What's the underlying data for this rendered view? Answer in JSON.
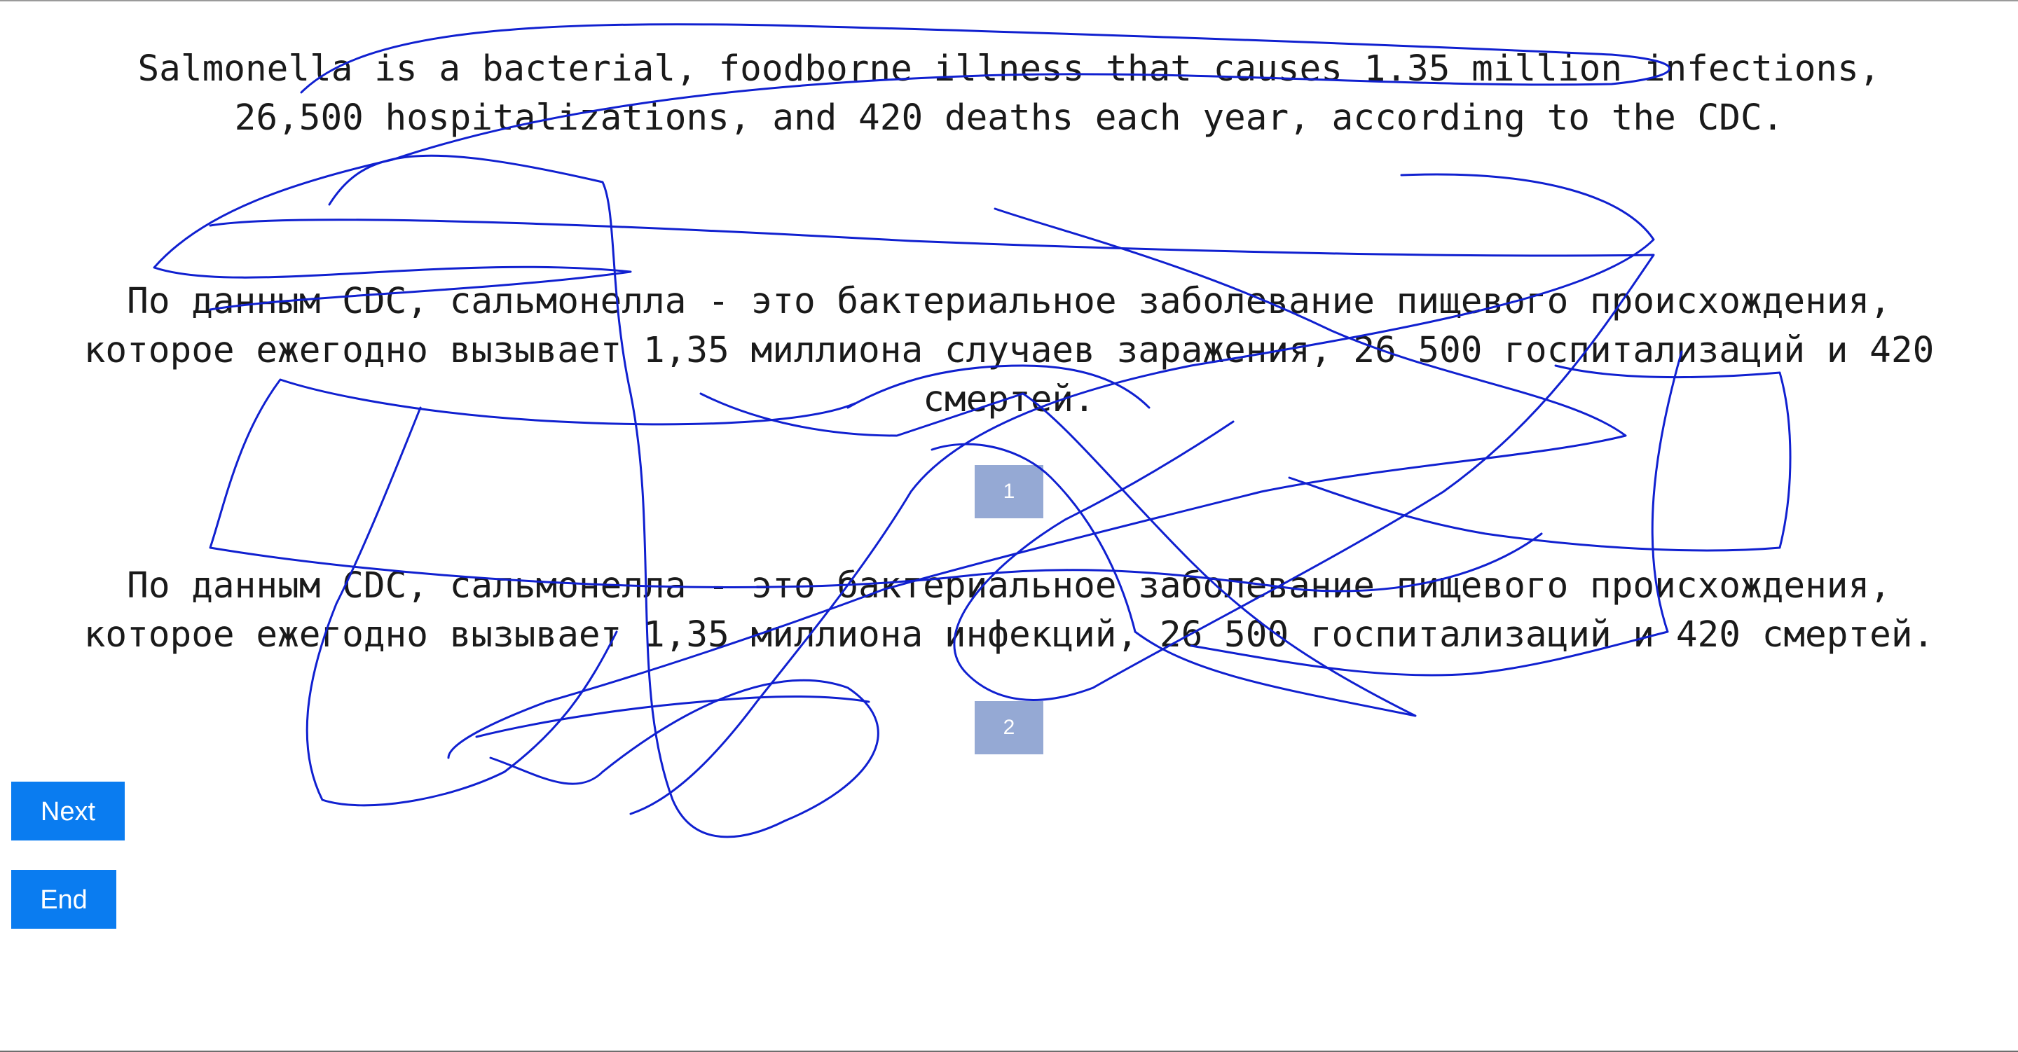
{
  "source": {
    "text": "Salmonella is a bacterial, foodborne illness that causes 1.35 million infections,\n26,500 hospitalizations, and 420 deaths each year, according to the CDC."
  },
  "translations": [
    {
      "text": "По данным CDC, сальмонелла - это бактериальное заболевание пищевого происхождения,\nкоторое ежегодно вызывает 1,35 миллиона случаев заражения, 26 500 госпитализаций и 420\nсмертей.",
      "choice_label": "1"
    },
    {
      "text": "По данным CDC, сальмонелла - это бактериальное заболевание пищевого происхождения,\nкоторое ежегодно вызывает 1,35 миллиона инфекций, 26 500 госпитализаций и 420 смертей.",
      "choice_label": "2"
    }
  ],
  "controls": {
    "next_label": "Next",
    "end_label": "End"
  },
  "colors": {
    "choice_button": "#95a9d4",
    "nav_button": "#0a7cf0",
    "scribble_stroke": "#1020d0"
  }
}
